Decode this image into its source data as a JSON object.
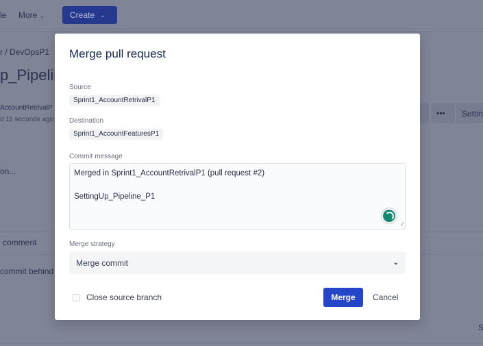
{
  "background": {
    "nav_partial": "le",
    "more_label": "More",
    "create_label": "Create",
    "breadcrumb_partial": "r  /  DevOpsP1",
    "title_partial": "p_Pipelin",
    "branch_partial": "AccountRetrivalP",
    "updated_partial": "d 11 seconds ago ·",
    "button_partial": "e",
    "more_actions": "•••",
    "settings_partial": "Settin",
    "description_partial": "on...",
    "comment_partial": "n comment",
    "behind_partial": "commit behind",
    "corner_partial": "S"
  },
  "modal": {
    "title": "Merge pull request",
    "source_label": "Source",
    "source_branch": "Sprint1_AccountRetrivalP1",
    "destination_label": "Destination",
    "destination_branch": "Sprint1_AccountFeaturesP1",
    "commit_message_label": "Commit message",
    "commit_message_line1": "Merged in Sprint1_AccountRetrivalP1 (pull request #2)",
    "commit_message_line2": "SettingUp_Pipeline_P1",
    "merge_strategy_label": "Merge strategy",
    "merge_strategy_value": "Merge commit",
    "close_source_branch_label": "Close source branch",
    "close_source_branch_checked": false,
    "merge_button": "Merge",
    "cancel_button": "Cancel"
  },
  "colors": {
    "primary": "#2346c8",
    "overlay": "#7f8497",
    "grammarly": "#15896f"
  }
}
